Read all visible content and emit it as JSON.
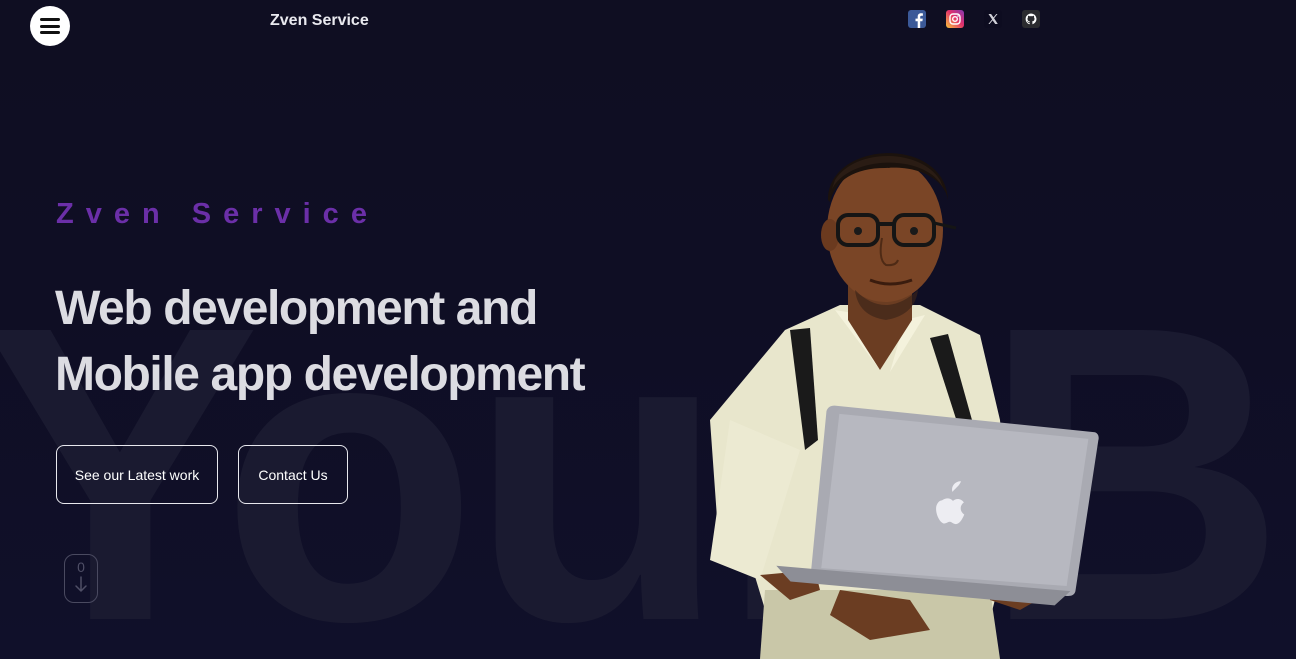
{
  "header": {
    "brand": "Zven Service",
    "socials": [
      {
        "name": "facebook",
        "icon": "facebook-icon"
      },
      {
        "name": "instagram",
        "icon": "instagram-icon"
      },
      {
        "name": "x",
        "icon": "x-icon"
      },
      {
        "name": "github",
        "icon": "github-icon"
      }
    ]
  },
  "hero": {
    "eyebrow": "Zven Service",
    "headline_line1": "Web development and",
    "headline_line2": "Mobile app development",
    "background_text": "Your Busin",
    "buttons": {
      "latest_work": "See our Latest work",
      "contact": "Contact Us"
    },
    "scroll_indicator": "0"
  },
  "colors": {
    "background": "#0f0e22",
    "eyebrow": "#6b2fa8",
    "headline": "#dcdce2",
    "button_border": "#e8e8ee"
  }
}
